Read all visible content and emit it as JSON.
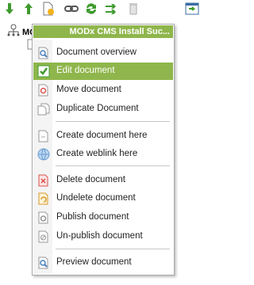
{
  "toolbar": {
    "icons": [
      "arrow-down-icon",
      "arrow-up-icon",
      "new-document-icon",
      "weblink-icon",
      "refresh-icon",
      "sort-icon",
      "trash-icon",
      "window-icon"
    ]
  },
  "tree": {
    "root_label": "MOD"
  },
  "menu": {
    "title": "MODx CMS Install Suc...",
    "accent": "#8fb64c",
    "items": [
      {
        "label": "Document overview",
        "icon": "magnifier-icon"
      },
      {
        "label": "Edit document",
        "icon": "checkmark-icon",
        "active": true
      },
      {
        "label": "Move document",
        "icon": "move-icon"
      },
      {
        "label": "Duplicate Document",
        "icon": "duplicate-icon"
      },
      {
        "label": "Create document here",
        "icon": "new-document-icon"
      },
      {
        "label": "Create weblink here",
        "icon": "globe-icon"
      },
      {
        "label": "Delete document",
        "icon": "delete-icon"
      },
      {
        "label": "Undelete document",
        "icon": "undelete-icon"
      },
      {
        "label": "Publish document",
        "icon": "publish-icon"
      },
      {
        "label": "Un-publish document",
        "icon": "unpublish-icon"
      },
      {
        "label": "Preview document",
        "icon": "preview-icon"
      }
    ]
  }
}
